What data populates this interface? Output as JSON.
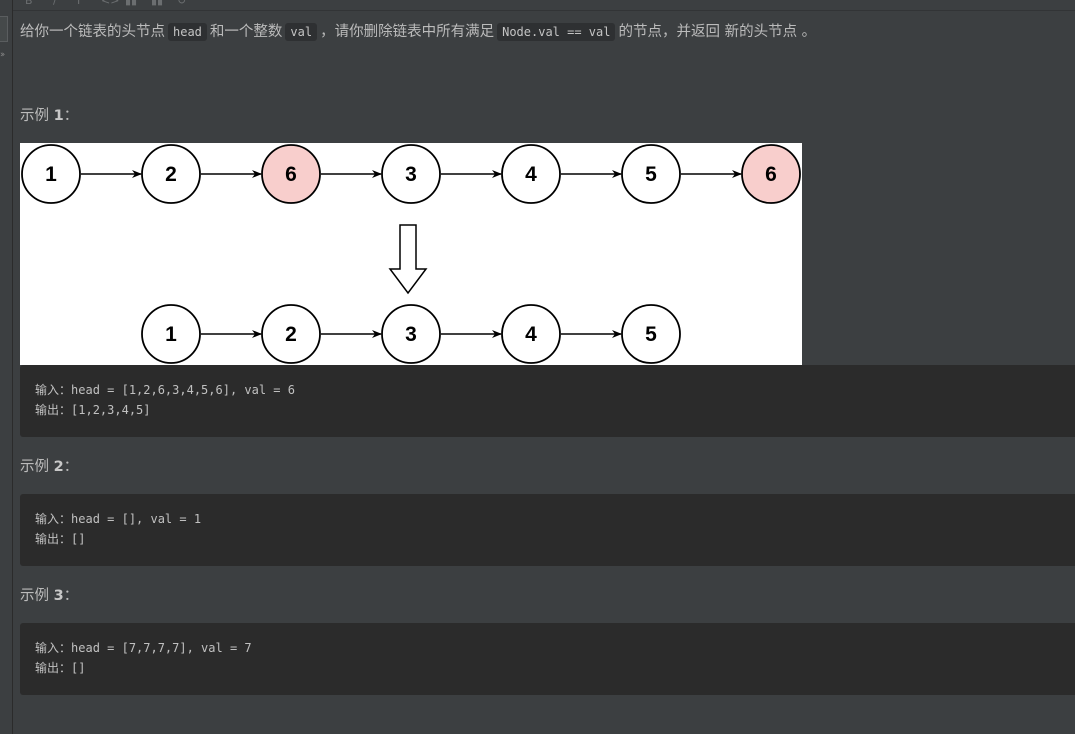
{
  "toolbar": {
    "icons": [
      "bold-icon",
      "italic-icon",
      "strikethrough-icon",
      "code-icon",
      "format-icon",
      "format-icon-2",
      "refresh-icon"
    ]
  },
  "description": {
    "part1": "给你一个链表的头节点",
    "code1": "head",
    "part2": "和一个整数",
    "code2": "val",
    "part3": "，请你删除链表中所有满足",
    "code3": "Node.val == val",
    "part4": "的节点，并返回 新的头节点 。"
  },
  "examples": [
    {
      "title_prefix": "示例 ",
      "title_num": "1",
      "title_suffix": "：",
      "input_label": "输入：",
      "input": "head = [1,2,6,3,4,5,6], val = 6",
      "output_label": "输出：",
      "output": "[1,2,3,4,5]"
    },
    {
      "title_prefix": "示例 ",
      "title_num": "2",
      "title_suffix": "：",
      "input_label": "输入：",
      "input": "head = [], val = 1",
      "output_label": "输出：",
      "output": "[]"
    },
    {
      "title_prefix": "示例 ",
      "title_num": "3",
      "title_suffix": "：",
      "input_label": "输入：",
      "input": "head = [7,7,7,7], val = 7",
      "output_label": "输出：",
      "output": "[]"
    }
  ],
  "figure": {
    "before": [
      {
        "label": "1",
        "removed": false
      },
      {
        "label": "2",
        "removed": false
      },
      {
        "label": "6",
        "removed": true
      },
      {
        "label": "3",
        "removed": false
      },
      {
        "label": "4",
        "removed": false
      },
      {
        "label": "5",
        "removed": false
      },
      {
        "label": "6",
        "removed": true
      }
    ],
    "after": [
      {
        "label": "1"
      },
      {
        "label": "2"
      },
      {
        "label": "3"
      },
      {
        "label": "4"
      },
      {
        "label": "5"
      }
    ],
    "colors": {
      "removed_fill": "#f8cecc",
      "node_fill": "#ffffff",
      "stroke": "#000000"
    }
  }
}
